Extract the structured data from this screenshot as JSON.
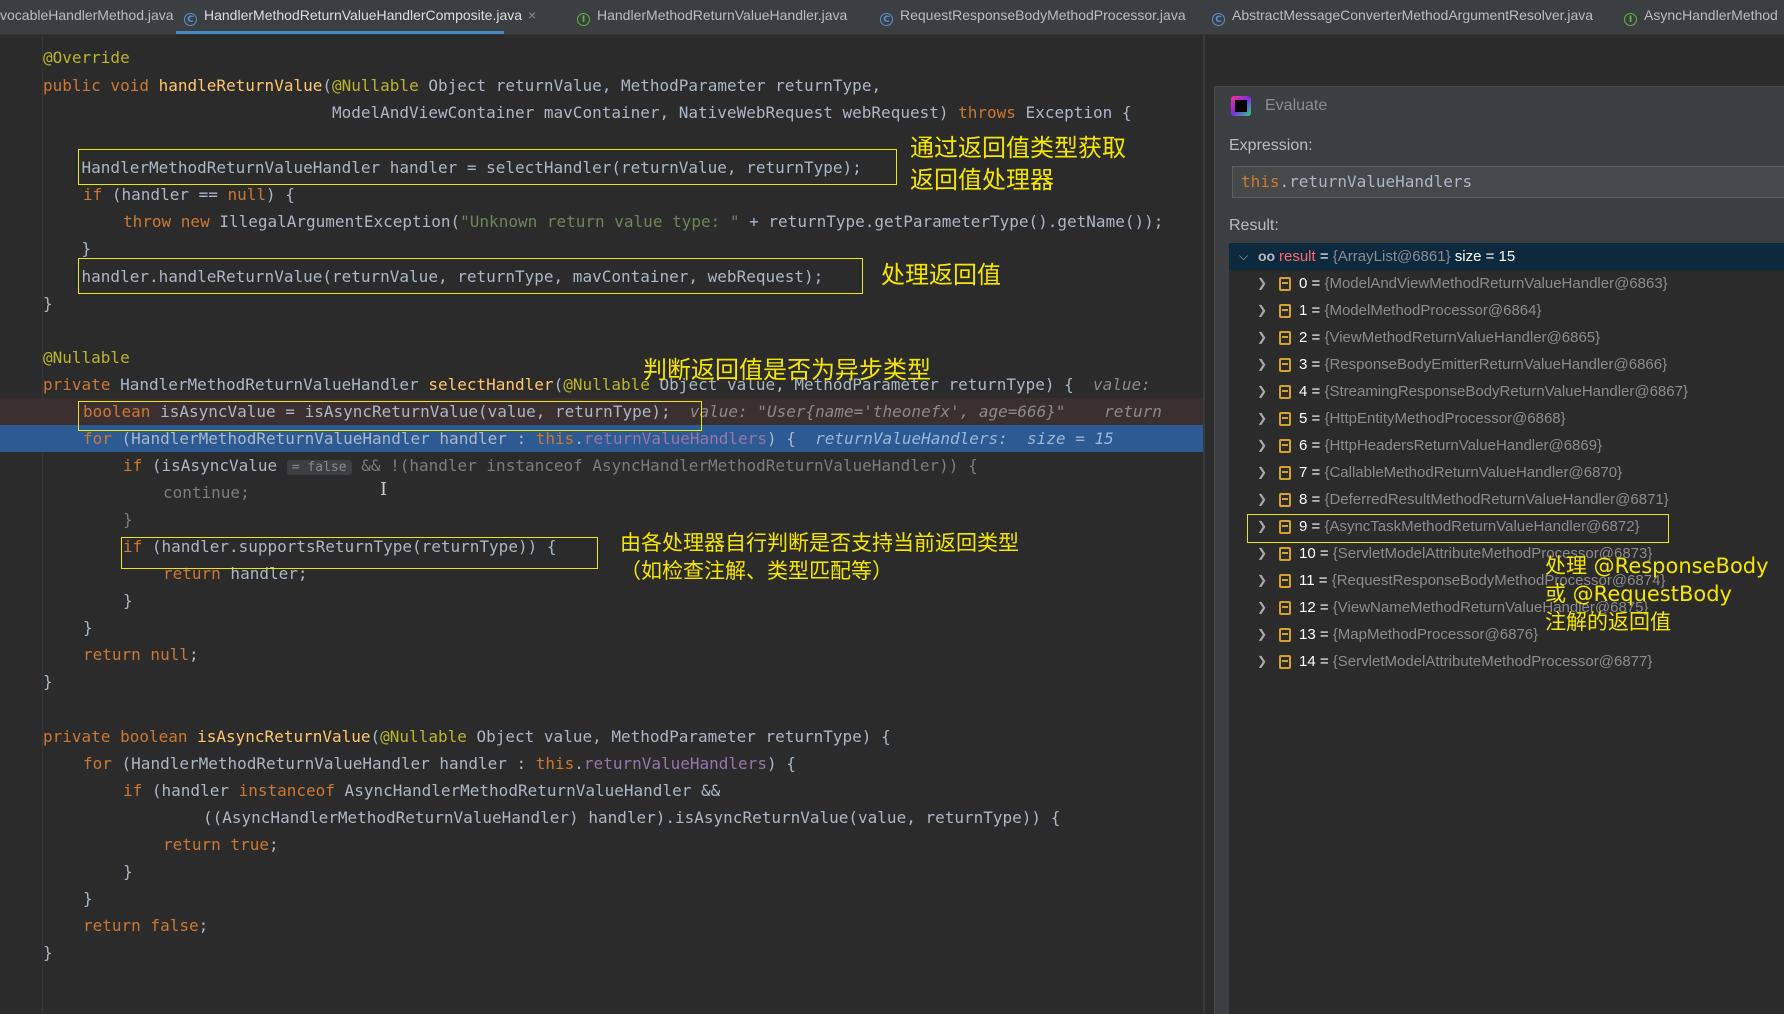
{
  "tabs": [
    {
      "label": "vocableHandlerMethod.java",
      "icon": "",
      "active": false
    },
    {
      "label": "HandlerMethodReturnValueHandlerComposite.java",
      "icon": "C",
      "active": true
    },
    {
      "label": "HandlerMethodReturnValueHandler.java",
      "icon": "I",
      "active": false
    },
    {
      "label": "RequestResponseBodyMethodProcessor.java",
      "icon": "C",
      "active": false
    },
    {
      "label": "AbstractMessageConverterMethodArgumentResolver.java",
      "icon": "C",
      "active": false
    },
    {
      "label": "AsyncHandlerMethod",
      "icon": "I",
      "active": false
    }
  ],
  "tab_close_glyph": "×",
  "code": {
    "l1": "@Override",
    "l2_kw": "public void ",
    "l2_fn": "handleReturnValue",
    "l2_ann": "@Nullable",
    "l2_rest": " Object returnValue, MethodParameter returnType,",
    "l3_a": "                              ModelAndViewContainer mavContainer, NativeWebRequest webRequest) ",
    "l3_kw": "throws",
    "l3_b": " Exception {",
    "l5": "    HandlerMethodReturnValueHandler handler = selectHandler(returnValue, returnType);",
    "l6_kw": "if",
    "l6_a": " (handler == ",
    "l6_null": "null",
    "l6_b": ") {",
    "l7_kw": "throw new",
    "l7_a": " IllegalArgumentException(",
    "l7_str": "\"Unknown return value type: \"",
    "l7_b": " + returnType.getParameterType().getName());",
    "l8": "    }",
    "l9": "    handler.handleReturnValue(returnValue, returnType, mavContainer, webRequest);",
    "l10": "}",
    "l12": "@Nullable",
    "l13_kw": "private",
    "l13_a": " HandlerMethodReturnValueHandler ",
    "l13_fn": "selectHandler",
    "l13_ann": "@Nullable",
    "l13_b": " Object value, MethodParameter returnType) {",
    "l13_hint": "value: ",
    "l14_kw": "boolean",
    "l14_a": " isAsyncValue = isAsyncReturnValue(value, returnType);",
    "l14_hint": "value: \"User{name='theonefx', age=666}\"",
    "l14_hint2": "return",
    "l15_kw": "for",
    "l15_a": " (HandlerMethodReturnValueHandler handler : ",
    "l15_this": "this",
    "l15_fld": "returnValueHandlers",
    "l15_b": ") {",
    "l15_hint": "returnValueHandlers:  size = 15",
    "l16_kw": "if",
    "l16_a": " (isAsyncValue",
    "l16_chip": "= false",
    "l16_b": " && !(handler instanceof AsyncHandlerMethodReturnValueHandler)) {",
    "l17": "continue;",
    "l18": "}",
    "l19_kw": "if",
    "l19_a": " (handler.supportsReturnType(returnType)) {",
    "l20_kw": "return",
    "l20_a": " handler;",
    "l21": "}",
    "l22": "}",
    "l23_kw": "return null",
    "l23_a": ";",
    "l24": "}",
    "l26_kw": "private boolean ",
    "l26_fn": "isAsyncReturnValue",
    "l26_ann": "@Nullable",
    "l26_a": " Object value, MethodParameter returnType) {",
    "l27_kw": "for",
    "l27_a": " (HandlerMethodReturnValueHandler handler : ",
    "l27_this": "this",
    "l27_fld": "returnValueHandlers",
    "l27_b": ") {",
    "l28_kw": "if",
    "l28_a": " (handler ",
    "l28_kw2": "instanceof",
    "l28_b": " AsyncHandlerMethodReturnValueHandler &&",
    "l29": "((AsyncHandlerMethodReturnValueHandler) handler).isAsyncReturnValue(value, returnType)) {",
    "l30_kw": "return true",
    "l30_a": ";",
    "l31": "}",
    "l32": "}",
    "l33_kw": "return false",
    "l33_a": ";",
    "l34": "}"
  },
  "notes": {
    "n1": "通过返回值类型获取\n返回值处理器",
    "n2": "处理返回值",
    "n3": "判断返回值是否为异步类型",
    "n4": "由各处理器自行判断是否支持当前返回类型\n（如检查注解、类型匹配等）",
    "n5": "处理 @ResponseBody\n或 @RequestBody\n注解的返回值"
  },
  "evaluate": {
    "title": "Evaluate",
    "expression_label": "Expression:",
    "expression_this": "this",
    "expression_rest": ".returnValueHandlers",
    "result_label": "Result:",
    "root": {
      "name": "result",
      "value": "{ArrayList@6861}",
      "size": "size = 15"
    },
    "items": [
      {
        "index": "0",
        "value": "{ModelAndViewMethodReturnValueHandler@6863}"
      },
      {
        "index": "1",
        "value": "{ModelMethodProcessor@6864}"
      },
      {
        "index": "2",
        "value": "{ViewMethodReturnValueHandler@6865}"
      },
      {
        "index": "3",
        "value": "{ResponseBodyEmitterReturnValueHandler@6866}"
      },
      {
        "index": "4",
        "value": "{StreamingResponseBodyReturnValueHandler@6867}"
      },
      {
        "index": "5",
        "value": "{HttpEntityMethodProcessor@6868}"
      },
      {
        "index": "6",
        "value": "{HttpHeadersReturnValueHandler@6869}"
      },
      {
        "index": "7",
        "value": "{CallableMethodReturnValueHandler@6870}"
      },
      {
        "index": "8",
        "value": "{DeferredResultMethodReturnValueHandler@6871}"
      },
      {
        "index": "9",
        "value": "{AsyncTaskMethodReturnValueHandler@6872}"
      },
      {
        "index": "10",
        "value": "{ServletModelAttributeMethodProcessor@6873}"
      },
      {
        "index": "11",
        "value": "{RequestResponseBodyMethodProcessor@6874}"
      },
      {
        "index": "12",
        "value": "{ViewNameMethodReturnValueHandler@6875}"
      },
      {
        "index": "13",
        "value": "{MapMethodProcessor@6876}"
      },
      {
        "index": "14",
        "value": "{ServletModelAttributeMethodProcessor@6877}"
      }
    ]
  },
  "colors": {
    "accent": "#4a88c7",
    "highlight_line": "#2d5a92",
    "annotation_box": "#e8e800",
    "annotation_text": "#f5e600",
    "keyword": "#cc7832"
  }
}
